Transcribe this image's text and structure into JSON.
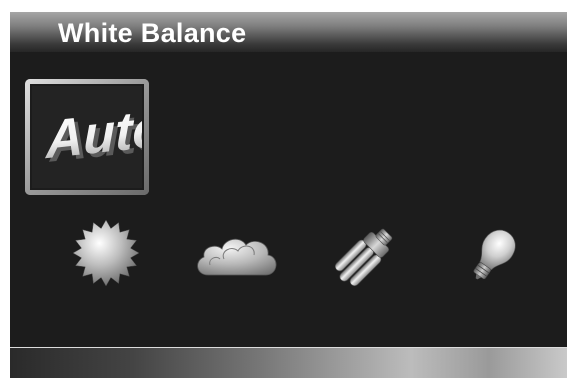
{
  "screen": {
    "title": "White Balance"
  },
  "auto_mode": {
    "label": "Auto",
    "icon": "auto-wb-icon",
    "selected": true
  },
  "modes": [
    {
      "icon": "daylight-sun-icon"
    },
    {
      "icon": "cloudy-icon"
    },
    {
      "icon": "fluorescent-bulb-icon"
    },
    {
      "icon": "tungsten-bulb-icon"
    }
  ],
  "colors": {
    "background": "#1c1c1c",
    "title_text": "#ffffff",
    "icon_fill": "#bdbdbd"
  }
}
